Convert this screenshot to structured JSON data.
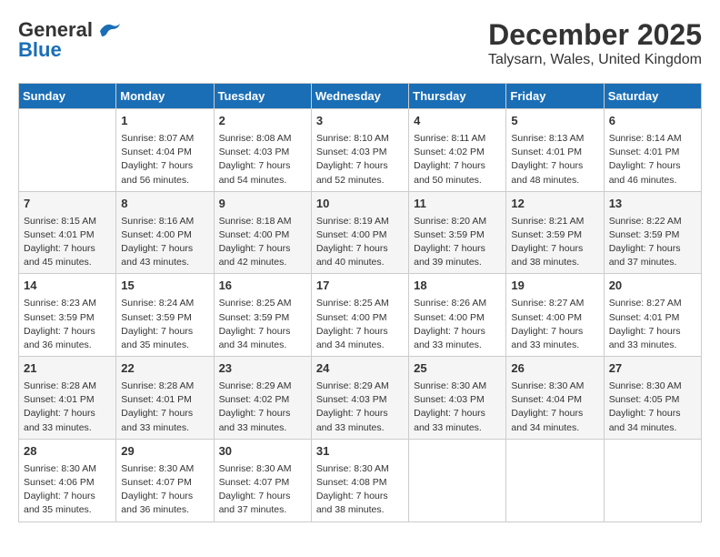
{
  "logo": {
    "line1": "General",
    "line2": "Blue"
  },
  "title": "December 2025",
  "subtitle": "Talysarn, Wales, United Kingdom",
  "days_of_week": [
    "Sunday",
    "Monday",
    "Tuesday",
    "Wednesday",
    "Thursday",
    "Friday",
    "Saturday"
  ],
  "weeks": [
    [
      {
        "day": "",
        "info": ""
      },
      {
        "day": "1",
        "info": "Sunrise: 8:07 AM\nSunset: 4:04 PM\nDaylight: 7 hours\nand 56 minutes."
      },
      {
        "day": "2",
        "info": "Sunrise: 8:08 AM\nSunset: 4:03 PM\nDaylight: 7 hours\nand 54 minutes."
      },
      {
        "day": "3",
        "info": "Sunrise: 8:10 AM\nSunset: 4:03 PM\nDaylight: 7 hours\nand 52 minutes."
      },
      {
        "day": "4",
        "info": "Sunrise: 8:11 AM\nSunset: 4:02 PM\nDaylight: 7 hours\nand 50 minutes."
      },
      {
        "day": "5",
        "info": "Sunrise: 8:13 AM\nSunset: 4:01 PM\nDaylight: 7 hours\nand 48 minutes."
      },
      {
        "day": "6",
        "info": "Sunrise: 8:14 AM\nSunset: 4:01 PM\nDaylight: 7 hours\nand 46 minutes."
      }
    ],
    [
      {
        "day": "7",
        "info": "Sunrise: 8:15 AM\nSunset: 4:01 PM\nDaylight: 7 hours\nand 45 minutes."
      },
      {
        "day": "8",
        "info": "Sunrise: 8:16 AM\nSunset: 4:00 PM\nDaylight: 7 hours\nand 43 minutes."
      },
      {
        "day": "9",
        "info": "Sunrise: 8:18 AM\nSunset: 4:00 PM\nDaylight: 7 hours\nand 42 minutes."
      },
      {
        "day": "10",
        "info": "Sunrise: 8:19 AM\nSunset: 4:00 PM\nDaylight: 7 hours\nand 40 minutes."
      },
      {
        "day": "11",
        "info": "Sunrise: 8:20 AM\nSunset: 3:59 PM\nDaylight: 7 hours\nand 39 minutes."
      },
      {
        "day": "12",
        "info": "Sunrise: 8:21 AM\nSunset: 3:59 PM\nDaylight: 7 hours\nand 38 minutes."
      },
      {
        "day": "13",
        "info": "Sunrise: 8:22 AM\nSunset: 3:59 PM\nDaylight: 7 hours\nand 37 minutes."
      }
    ],
    [
      {
        "day": "14",
        "info": "Sunrise: 8:23 AM\nSunset: 3:59 PM\nDaylight: 7 hours\nand 36 minutes."
      },
      {
        "day": "15",
        "info": "Sunrise: 8:24 AM\nSunset: 3:59 PM\nDaylight: 7 hours\nand 35 minutes."
      },
      {
        "day": "16",
        "info": "Sunrise: 8:25 AM\nSunset: 3:59 PM\nDaylight: 7 hours\nand 34 minutes."
      },
      {
        "day": "17",
        "info": "Sunrise: 8:25 AM\nSunset: 4:00 PM\nDaylight: 7 hours\nand 34 minutes."
      },
      {
        "day": "18",
        "info": "Sunrise: 8:26 AM\nSunset: 4:00 PM\nDaylight: 7 hours\nand 33 minutes."
      },
      {
        "day": "19",
        "info": "Sunrise: 8:27 AM\nSunset: 4:00 PM\nDaylight: 7 hours\nand 33 minutes."
      },
      {
        "day": "20",
        "info": "Sunrise: 8:27 AM\nSunset: 4:01 PM\nDaylight: 7 hours\nand 33 minutes."
      }
    ],
    [
      {
        "day": "21",
        "info": "Sunrise: 8:28 AM\nSunset: 4:01 PM\nDaylight: 7 hours\nand 33 minutes."
      },
      {
        "day": "22",
        "info": "Sunrise: 8:28 AM\nSunset: 4:01 PM\nDaylight: 7 hours\nand 33 minutes."
      },
      {
        "day": "23",
        "info": "Sunrise: 8:29 AM\nSunset: 4:02 PM\nDaylight: 7 hours\nand 33 minutes."
      },
      {
        "day": "24",
        "info": "Sunrise: 8:29 AM\nSunset: 4:03 PM\nDaylight: 7 hours\nand 33 minutes."
      },
      {
        "day": "25",
        "info": "Sunrise: 8:30 AM\nSunset: 4:03 PM\nDaylight: 7 hours\nand 33 minutes."
      },
      {
        "day": "26",
        "info": "Sunrise: 8:30 AM\nSunset: 4:04 PM\nDaylight: 7 hours\nand 34 minutes."
      },
      {
        "day": "27",
        "info": "Sunrise: 8:30 AM\nSunset: 4:05 PM\nDaylight: 7 hours\nand 34 minutes."
      }
    ],
    [
      {
        "day": "28",
        "info": "Sunrise: 8:30 AM\nSunset: 4:06 PM\nDaylight: 7 hours\nand 35 minutes."
      },
      {
        "day": "29",
        "info": "Sunrise: 8:30 AM\nSunset: 4:07 PM\nDaylight: 7 hours\nand 36 minutes."
      },
      {
        "day": "30",
        "info": "Sunrise: 8:30 AM\nSunset: 4:07 PM\nDaylight: 7 hours\nand 37 minutes."
      },
      {
        "day": "31",
        "info": "Sunrise: 8:30 AM\nSunset: 4:08 PM\nDaylight: 7 hours\nand 38 minutes."
      },
      {
        "day": "",
        "info": ""
      },
      {
        "day": "",
        "info": ""
      },
      {
        "day": "",
        "info": ""
      }
    ]
  ]
}
